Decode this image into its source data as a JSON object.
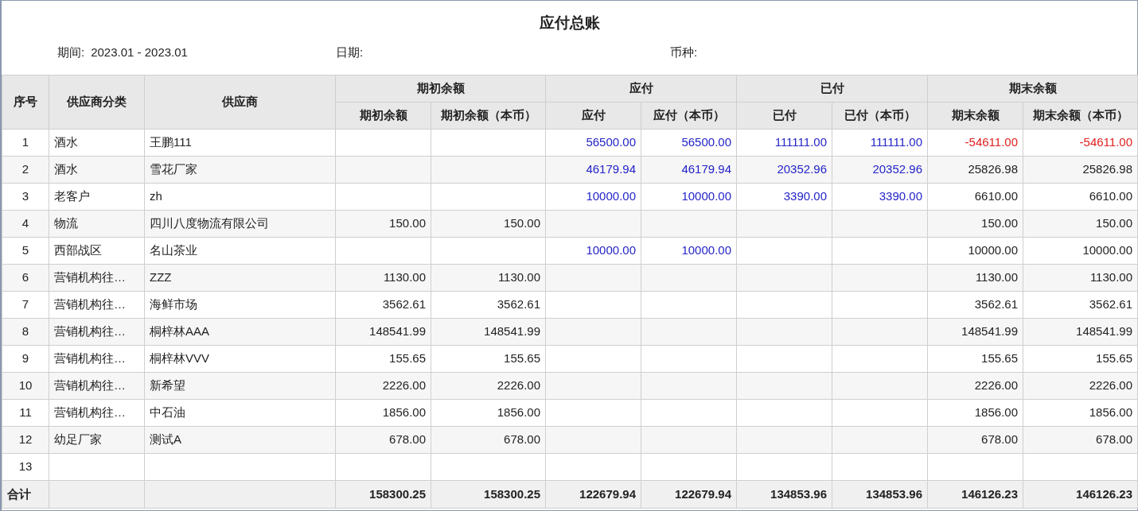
{
  "title": "应付总账",
  "filters": [
    {
      "label": "期间:",
      "value": "2023.01 - 2023.01"
    },
    {
      "label": "日期:"
    },
    {
      "label": "币种:"
    }
  ],
  "table": {
    "fixed_columns": [
      "序号",
      "供应商分类",
      "供应商"
    ],
    "groups": [
      {
        "label": "期初余额",
        "columns": [
          {
            "label": "期初余额",
            "kind": "plain"
          },
          {
            "label": "期初余额（本币）",
            "kind": "plain"
          }
        ]
      },
      {
        "label": "应付",
        "columns": [
          {
            "label": "应付",
            "kind": "link"
          },
          {
            "label": "应付（本币）",
            "kind": "link"
          }
        ]
      },
      {
        "label": "已付",
        "columns": [
          {
            "label": "已付",
            "kind": "link"
          },
          {
            "label": "已付（本币）",
            "kind": "link"
          }
        ]
      },
      {
        "label": "期末余额",
        "columns": [
          {
            "label": "期末余额",
            "kind": "plain"
          },
          {
            "label": "期末余额（本币）",
            "kind": "plain"
          }
        ]
      }
    ],
    "rows": [
      {
        "no": "1",
        "category": "酒水",
        "supplier": "王鹏111",
        "values": {
          "payable": {
            "text": "56500.00",
            "negative": false
          },
          "payable_base": {
            "text": "56500.00",
            "negative": false
          },
          "paid": {
            "text": "111111.00",
            "negative": false
          },
          "paid_base": {
            "text": "111111.00",
            "negative": false
          },
          "closing": {
            "text": "-54611.00",
            "negative": true
          },
          "closing_base": {
            "text": "-54611.00",
            "negative": true
          }
        }
      },
      {
        "no": "2",
        "category": "酒水",
        "supplier": "雪花厂家",
        "values": {
          "payable": {
            "text": "46179.94",
            "negative": false
          },
          "payable_base": {
            "text": "46179.94",
            "negative": false
          },
          "paid": {
            "text": "20352.96",
            "negative": false
          },
          "paid_base": {
            "text": "20352.96",
            "negative": false
          },
          "closing": {
            "text": "25826.98",
            "negative": false
          },
          "closing_base": {
            "text": "25826.98",
            "negative": false
          }
        }
      },
      {
        "no": "3",
        "category": "老客户",
        "supplier": "zh",
        "values": {
          "payable": {
            "text": "10000.00",
            "negative": false
          },
          "payable_base": {
            "text": "10000.00",
            "negative": false
          },
          "paid": {
            "text": "3390.00",
            "negative": false
          },
          "paid_base": {
            "text": "3390.00",
            "negative": false
          },
          "closing": {
            "text": "6610.00",
            "negative": false
          },
          "closing_base": {
            "text": "6610.00",
            "negative": false
          }
        }
      },
      {
        "no": "4",
        "category": "物流",
        "supplier": "四川八度物流有限公司",
        "values": {
          "opening": {
            "text": "150.00",
            "negative": false
          },
          "opening_base": {
            "text": "150.00",
            "negative": false
          },
          "closing": {
            "text": "150.00",
            "negative": false
          },
          "closing_base": {
            "text": "150.00",
            "negative": false
          }
        }
      },
      {
        "no": "5",
        "category": "西部战区",
        "supplier": "名山茶业",
        "values": {
          "payable": {
            "text": "10000.00",
            "negative": false
          },
          "payable_base": {
            "text": "10000.00",
            "negative": false
          },
          "closing": {
            "text": "10000.00",
            "negative": false
          },
          "closing_base": {
            "text": "10000.00",
            "negative": false
          }
        }
      },
      {
        "no": "6",
        "category": "营销机构往…",
        "supplier": "ZZZ",
        "values": {
          "opening": {
            "text": "1130.00",
            "negative": false
          },
          "opening_base": {
            "text": "1130.00",
            "negative": false
          },
          "closing": {
            "text": "1130.00",
            "negative": false
          },
          "closing_base": {
            "text": "1130.00",
            "negative": false
          }
        }
      },
      {
        "no": "7",
        "category": "营销机构往…",
        "supplier": "海鲜市场",
        "values": {
          "opening": {
            "text": "3562.61",
            "negative": false
          },
          "opening_base": {
            "text": "3562.61",
            "negative": false
          },
          "closing": {
            "text": "3562.61",
            "negative": false
          },
          "closing_base": {
            "text": "3562.61",
            "negative": false
          }
        }
      },
      {
        "no": "8",
        "category": "营销机构往…",
        "supplier": "桐梓林AAA",
        "values": {
          "opening": {
            "text": "148541.99",
            "negative": false
          },
          "opening_base": {
            "text": "148541.99",
            "negative": false
          },
          "closing": {
            "text": "148541.99",
            "negative": false
          },
          "closing_base": {
            "text": "148541.99",
            "negative": false
          }
        }
      },
      {
        "no": "9",
        "category": "营销机构往…",
        "supplier": "桐梓林VVV",
        "values": {
          "opening": {
            "text": "155.65",
            "negative": false
          },
          "opening_base": {
            "text": "155.65",
            "negative": false
          },
          "closing": {
            "text": "155.65",
            "negative": false
          },
          "closing_base": {
            "text": "155.65",
            "negative": false
          }
        }
      },
      {
        "no": "10",
        "category": "营销机构往…",
        "supplier": "新希望",
        "values": {
          "opening": {
            "text": "2226.00",
            "negative": false
          },
          "opening_base": {
            "text": "2226.00",
            "negative": false
          },
          "closing": {
            "text": "2226.00",
            "negative": false
          },
          "closing_base": {
            "text": "2226.00",
            "negative": false
          }
        }
      },
      {
        "no": "11",
        "category": "营销机构往…",
        "supplier": "中石油",
        "values": {
          "opening": {
            "text": "1856.00",
            "negative": false
          },
          "opening_base": {
            "text": "1856.00",
            "negative": false
          },
          "closing": {
            "text": "1856.00",
            "negative": false
          },
          "closing_base": {
            "text": "1856.00",
            "negative": false
          }
        }
      },
      {
        "no": "12",
        "category": "幼足厂家",
        "supplier": "测试A",
        "values": {
          "opening": {
            "text": "678.00",
            "negative": false
          },
          "opening_base": {
            "text": "678.00",
            "negative": false
          },
          "closing": {
            "text": "678.00",
            "negative": false
          },
          "closing_base": {
            "text": "678.00",
            "negative": false
          }
        }
      },
      {
        "no": "13"
      }
    ],
    "total": {
      "label": "合计",
      "values": [
        "158300.25",
        "158300.25",
        "122679.94",
        "122679.94",
        "134853.96",
        "134853.96",
        "146126.23",
        "146126.23"
      ]
    }
  }
}
